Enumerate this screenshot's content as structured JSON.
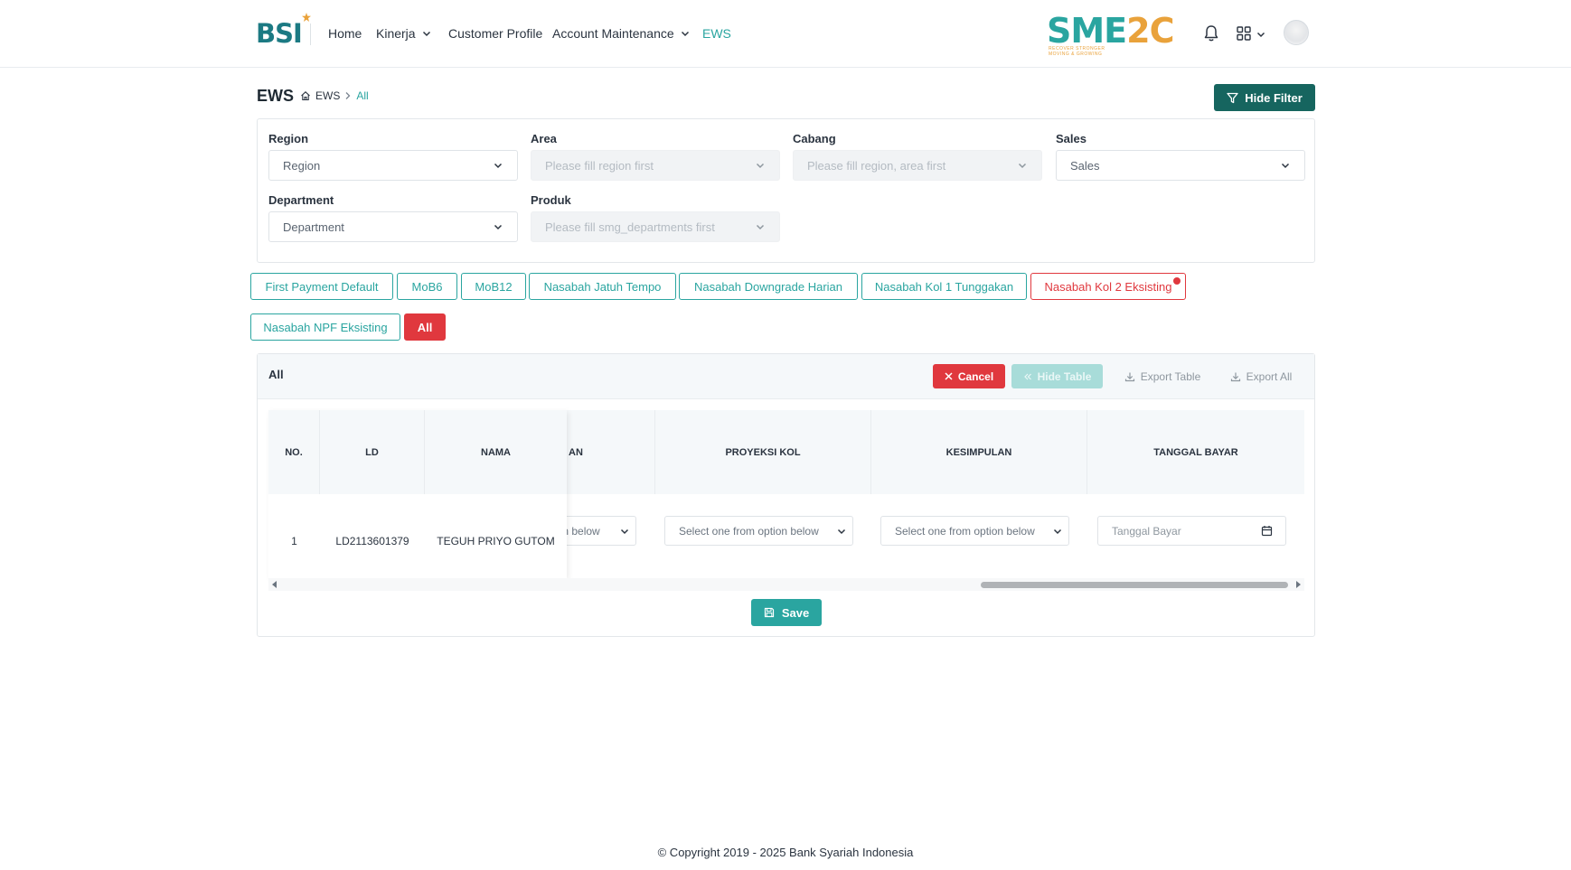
{
  "navbar": {
    "logo_text": "BSI",
    "items": [
      {
        "label": "Home"
      },
      {
        "label": "Kinerja"
      },
      {
        "label": "Customer Profile"
      },
      {
        "label": "Account Maintenance"
      },
      {
        "label": "EWS"
      }
    ],
    "sme_logo": {
      "text_sme": "SME",
      "text_num": "2C",
      "tagline_1": "RECOVER STRONGER",
      "tagline_2": "MOVING & GROWING"
    },
    "icons": [
      "bell-icon",
      "apps-grid-icon",
      "chevron-down-icon",
      "avatar"
    ]
  },
  "header": {
    "title": "EWS",
    "breadcrumb": {
      "root": "EWS",
      "current": "All"
    },
    "hide_filter_label": "Hide Filter"
  },
  "filters": {
    "region": {
      "label": "Region",
      "value": "Region"
    },
    "area": {
      "label": "Area",
      "placeholder": "Please fill region first"
    },
    "cabang": {
      "label": "Cabang",
      "placeholder": "Please fill region, area first"
    },
    "sales": {
      "label": "Sales",
      "value": "Sales"
    },
    "department": {
      "label": "Department",
      "value": "Department"
    },
    "produk": {
      "label": "Produk",
      "placeholder": "Please fill smg_departments first"
    }
  },
  "tabs": [
    {
      "label": "First Payment Default"
    },
    {
      "label": "MoB6"
    },
    {
      "label": "MoB12"
    },
    {
      "label": "Nasabah Jatuh Tempo"
    },
    {
      "label": "Nasabah Downgrade Harian"
    },
    {
      "label": "Nasabah Kol 1 Tunggakan"
    },
    {
      "label": "Nasabah Kol 2 Eksisting"
    },
    {
      "label": "Nasabah NPF Eksisting"
    },
    {
      "label": "All"
    }
  ],
  "table_card": {
    "title": "All",
    "cancel_label": "Cancel",
    "hide_table_label": "Hide Table",
    "export_table_label": "Export Table",
    "export_all_label": "Export All",
    "columns": {
      "no": "NO.",
      "ld": "LD",
      "nama": "NAMA",
      "partial": "AN",
      "proyeksi_kol": "PROYEKSI KOL",
      "kesimpulan": "KESIMPULAN",
      "tanggal_bayar": "TANGGAL BAYAR"
    },
    "rows": [
      {
        "no": "1",
        "ld": "LD2113601379",
        "nama": "TEGUH PRIYO GUTOM",
        "partial_select": "ion below",
        "proyeksi_kol": "Select one from option below",
        "kesimpulan": "Select one from option below",
        "tanggal_bayar_placeholder": "Tanggal Bayar"
      }
    ],
    "save_label": "Save"
  },
  "footer": {
    "text": "© Copyright 2019 - 2025 Bank Syariah Indonesia"
  },
  "colors": {
    "teal": "#2aa5a0",
    "dark_teal": "#16655f",
    "red": "#e0383e",
    "orange": "#e9a23b"
  }
}
